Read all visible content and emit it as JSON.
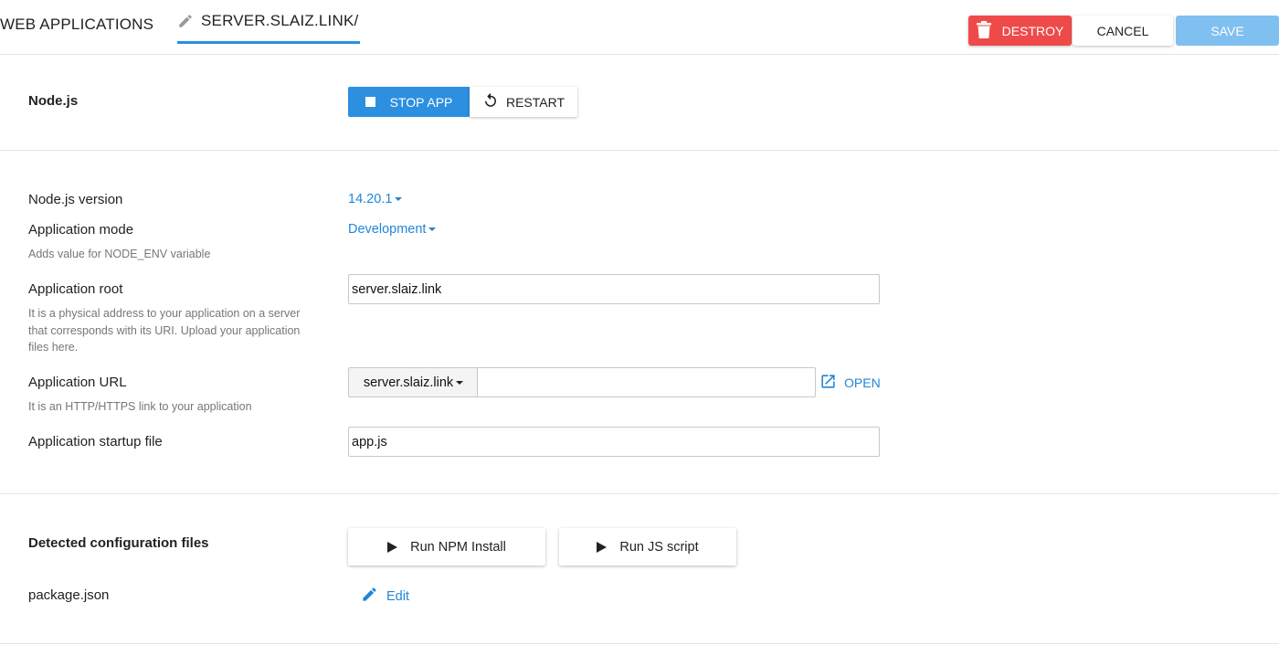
{
  "header": {
    "nav_apps": "WEB APPLICATIONS",
    "nav_current": "SERVER.SLAIZ.LINK/",
    "destroy_label": "DESTROY",
    "cancel_label": "CANCEL",
    "save_label": "SAVE"
  },
  "app_section": {
    "title": "Node.js",
    "stop_label": "STOP APP",
    "restart_label": "RESTART"
  },
  "settings": {
    "node_version_label": "Node.js version",
    "node_version_value": "14.20.1",
    "mode_label": "Application mode",
    "mode_value": "Development",
    "mode_hint": "Adds value for NODE_ENV variable",
    "root_label": "Application root",
    "root_hint": "It is a physical address to your application on a server that corresponds with its URI. Upload your application files here.",
    "root_value": "server.slaiz.link",
    "url_label": "Application URL",
    "url_hint": "It is an HTTP/HTTPS link to your application",
    "url_domain": "server.slaiz.link",
    "url_path_value": "",
    "open_label": "OPEN",
    "startup_label": "Application startup file",
    "startup_value": "app.js"
  },
  "config_section": {
    "title": "Detected configuration files",
    "run_npm_label": "Run NPM Install",
    "run_js_label": "Run JS script",
    "file_name": "package.json",
    "edit_label": "Edit"
  },
  "colors": {
    "accent": "#2d8fe0",
    "link": "#1f86d8",
    "danger": "#ef4a4a",
    "save_disabled": "#7fc0f0"
  },
  "icons": [
    "pencil-icon",
    "trash-icon",
    "stop-icon",
    "restart-icon",
    "caret-down-icon",
    "external-link-icon",
    "play-icon",
    "edit-icon"
  ]
}
